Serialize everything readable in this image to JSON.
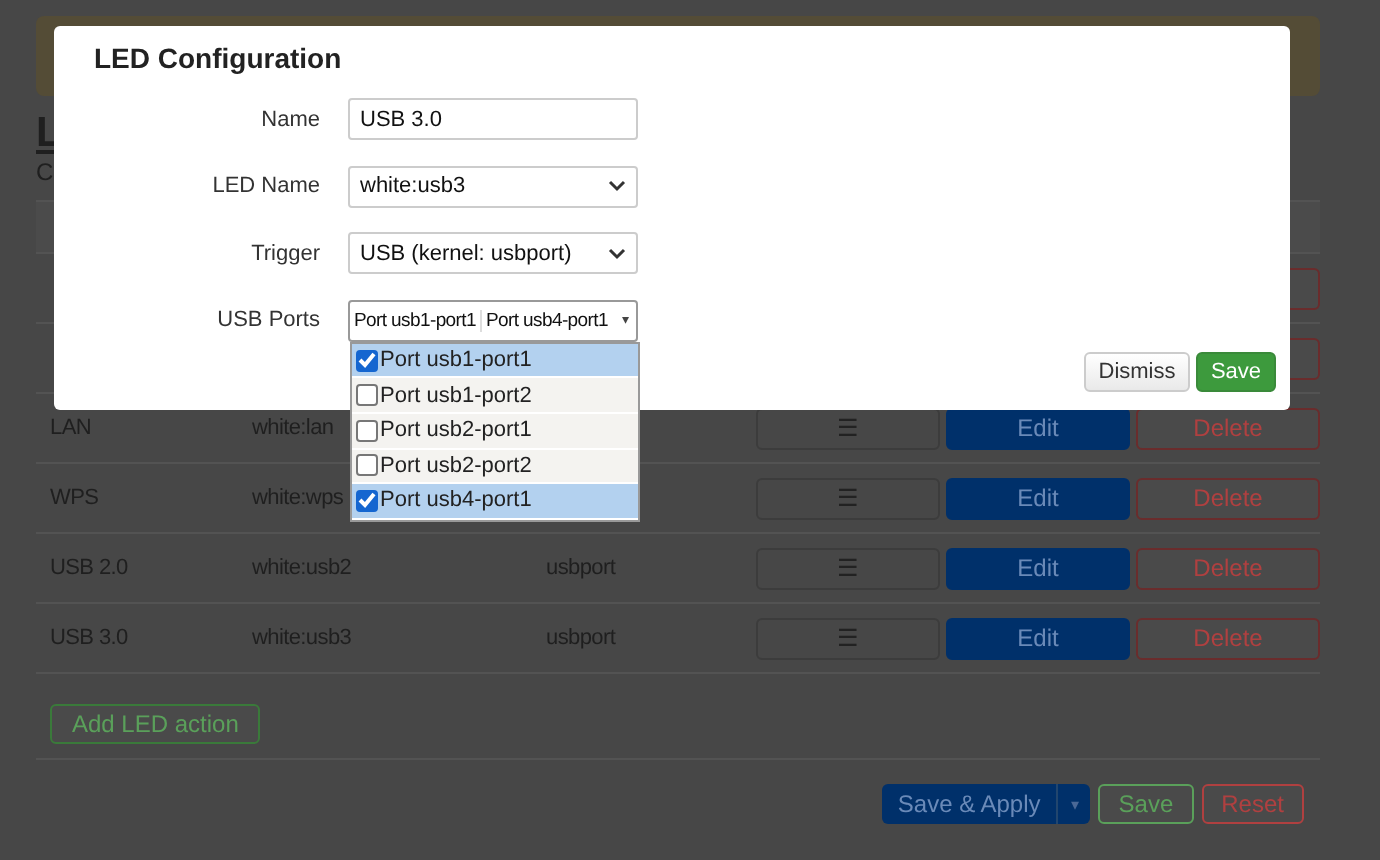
{
  "page": {
    "heading": "L",
    "subtitle": "C"
  },
  "table": {
    "rows": [
      {
        "buttons": []
      },
      {
        "buttons": []
      },
      {
        "name": "LAN",
        "led": "white:lan",
        "buttons": [
          "☰",
          "Edit",
          "Delete"
        ]
      },
      {
        "name": "WPS",
        "led": "white:wps",
        "buttons": [
          "☰",
          "Edit",
          "Delete"
        ]
      },
      {
        "name": "USB 2.0",
        "led": "white:usb2",
        "trigger": "usbport",
        "buttons": [
          "☰",
          "Edit",
          "Delete"
        ]
      },
      {
        "name": "USB 3.0",
        "led": "white:usb3",
        "trigger": "usbport",
        "buttons": [
          "☰",
          "Edit",
          "Delete"
        ]
      }
    ]
  },
  "add_button": "Add LED action",
  "footer": {
    "save_apply": "Save & Apply",
    "save_apply_caret": "▾",
    "save": "Save",
    "reset": "Reset"
  },
  "modal": {
    "title": "LED Configuration",
    "fields": [
      {
        "kind": "text",
        "label": "Name",
        "value": "USB 3.0"
      },
      {
        "kind": "select",
        "label": "LED Name",
        "value": "white:usb3"
      },
      {
        "kind": "select",
        "label": "Trigger",
        "value": "USB (kernel: usbport)"
      },
      {
        "kind": "multi",
        "label": "USB Ports",
        "values": [
          "Port usb1-port1",
          "Port usb4-port1"
        ],
        "caret": "▾",
        "expanded": true,
        "options": [
          {
            "label": "Port usb1-port1",
            "checked": true
          },
          {
            "label": "Port usb1-port2",
            "checked": false
          },
          {
            "label": "Port usb2-port1",
            "checked": false
          },
          {
            "label": "Port usb2-port2",
            "checked": false
          },
          {
            "label": "Port usb4-port1",
            "checked": true
          }
        ]
      }
    ],
    "buttons": {
      "dismiss": "Dismiss",
      "save": "Save"
    }
  }
}
